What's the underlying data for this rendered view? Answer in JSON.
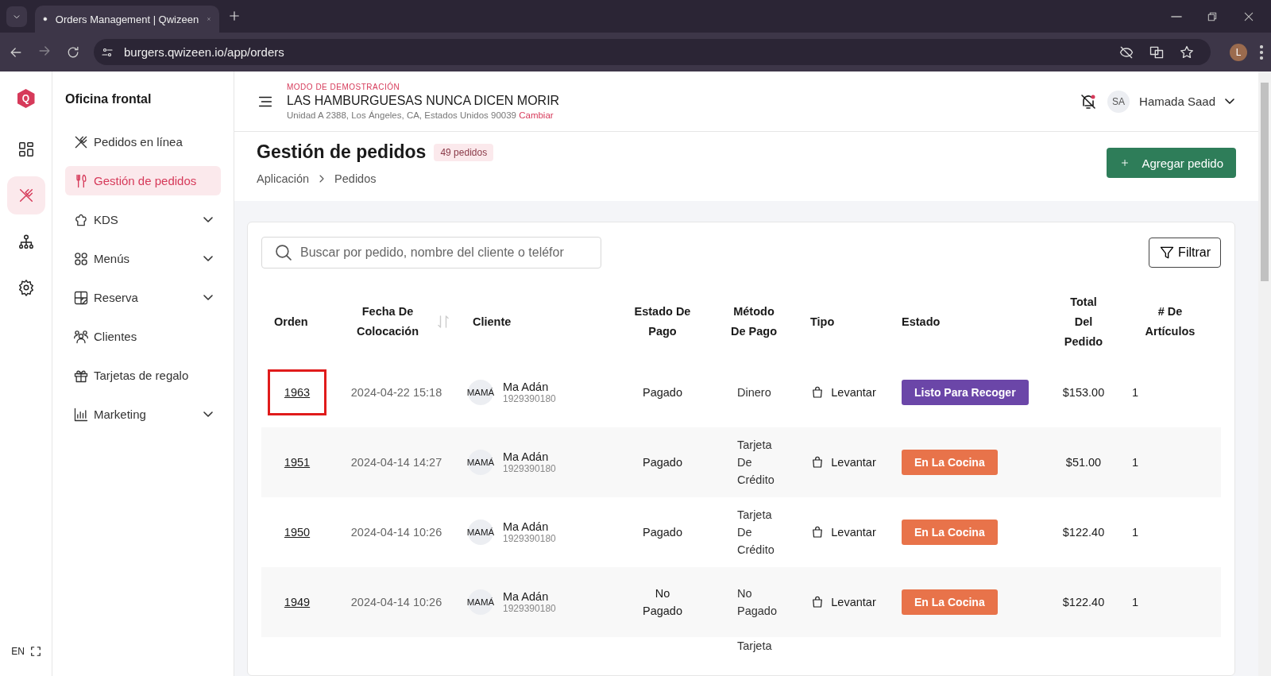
{
  "browser": {
    "tab_title": "Orders Management | Qwizeen",
    "url": "burgers.qwizeen.io/app/orders",
    "profile_initial": "L"
  },
  "rail": {
    "logo_letter": "Q",
    "items": [
      {
        "kind": "dashboard",
        "selected": false
      },
      {
        "kind": "orders",
        "selected": true
      },
      {
        "kind": "network",
        "selected": false
      },
      {
        "kind": "settings",
        "selected": false
      }
    ],
    "language": "EN"
  },
  "nav": {
    "title": "Oficina frontal",
    "items": [
      {
        "kind": "online",
        "label": "Pedidos en línea",
        "selected": false,
        "expandable": false
      },
      {
        "kind": "orders",
        "label": "Gestión de pedidos",
        "selected": true,
        "expandable": false
      },
      {
        "kind": "chef",
        "label": "KDS",
        "selected": false,
        "expandable": true
      },
      {
        "kind": "menus",
        "label": "Menús",
        "selected": false,
        "expandable": true
      },
      {
        "kind": "reserve",
        "label": "Reserva",
        "selected": false,
        "expandable": true
      },
      {
        "kind": "clients",
        "label": "Clientes",
        "selected": false,
        "expandable": false
      },
      {
        "kind": "gift",
        "label": "Tarjetas de regalo",
        "selected": false,
        "expandable": false
      },
      {
        "kind": "chart",
        "label": "Marketing",
        "selected": false,
        "expandable": true
      }
    ]
  },
  "header": {
    "demo_label": "MODO DE DEMOSTRACIÓN",
    "restaurant": "LAS HAMBURGUESAS NUNCA DICEN MORIR",
    "address": "Unidad A 2388, Los Ángeles, CA, Estados Unidos 90039",
    "change_link": "Cambiar",
    "user_initials": "SA",
    "user_name": "Hamada Saad"
  },
  "page": {
    "title": "Gestión de pedidos",
    "count_badge": "49 pedidos",
    "breadcrumb": [
      "Aplicación",
      "Pedidos"
    ],
    "add_button": "Agregar pedido"
  },
  "search": {
    "placeholder": "Buscar por pedido, nombre del cliente o teléfor"
  },
  "filter_button": "Filtrar",
  "table": {
    "columns": [
      {
        "label": "Orden",
        "sortable": false
      },
      {
        "label": "Fecha De Colocación",
        "sortable": true
      },
      {
        "label": "Cliente",
        "sortable": false
      },
      {
        "label": "Estado De Pago",
        "sortable": false
      },
      {
        "label": "Método De Pago",
        "sortable": false
      },
      {
        "label": "Tipo",
        "sortable": false
      },
      {
        "label": "Estado",
        "sortable": false
      },
      {
        "label": "Total Del Pedido",
        "sortable": false
      },
      {
        "label": "# De Artículos",
        "sortable": false
      }
    ],
    "rows": [
      {
        "order": "1963",
        "highlighted": true,
        "date": "2024-04-22 15:18",
        "avatar": "MAMÁ",
        "customer": "Ma Adán",
        "phone": "1929390180",
        "payment_status": "Pagado",
        "payment_method": "Dinero",
        "type": "Levantar",
        "status": {
          "label": "Listo Para Recoger",
          "kind": "ready"
        },
        "total": "$153.00",
        "items": "1"
      },
      {
        "order": "1951",
        "highlighted": false,
        "date": "2024-04-14 14:27",
        "avatar": "MAMÁ",
        "customer": "Ma Adán",
        "phone": "1929390180",
        "payment_status": "Pagado",
        "payment_method": "Tarjeta De Crédito",
        "type": "Levantar",
        "status": {
          "label": "En La Cocina",
          "kind": "kitchen"
        },
        "total": "$51.00",
        "items": "1"
      },
      {
        "order": "1950",
        "highlighted": false,
        "date": "2024-04-14 10:26",
        "avatar": "MAMÁ",
        "customer": "Ma Adán",
        "phone": "1929390180",
        "payment_status": "Pagado",
        "payment_method": "Tarjeta De Crédito",
        "type": "Levantar",
        "status": {
          "label": "En La Cocina",
          "kind": "kitchen"
        },
        "total": "$122.40",
        "items": "1"
      },
      {
        "order": "1949",
        "highlighted": false,
        "date": "2024-04-14 10:26",
        "avatar": "MAMÁ",
        "customer": "Ma Adán",
        "phone": "1929390180",
        "payment_status": "No Pagado",
        "payment_method": "No Pagado",
        "type": "Levantar",
        "status": {
          "label": "En La Cocina",
          "kind": "kitchen"
        },
        "total": "$122.40",
        "items": "1"
      },
      {
        "payment_method": "Tarjeta"
      }
    ]
  }
}
